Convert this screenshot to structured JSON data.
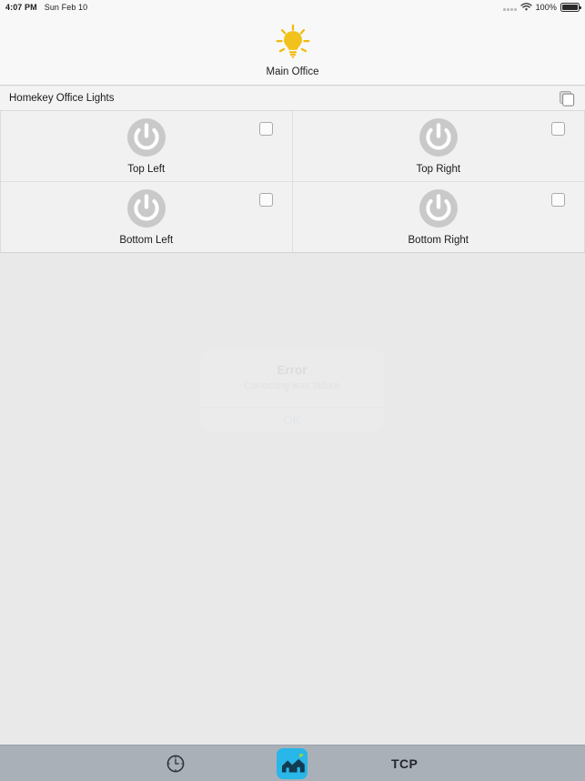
{
  "statusbar": {
    "time": "4:07 PM",
    "date": "Sun Feb 10",
    "battery_percent": "100%",
    "signal_icon": "signal-dots-icon",
    "wifi_icon": "wifi-icon",
    "battery_icon": "battery-full-icon"
  },
  "header": {
    "room_name": "Main Office",
    "room_icon": "lightbulb-icon",
    "icon_color": "#f2b90c"
  },
  "section": {
    "title": "Homekey Office Lights",
    "action_icon": "copy-icon"
  },
  "devices": [
    {
      "label": "Top Left",
      "icon": "power-icon",
      "checked": false
    },
    {
      "label": "Top Right",
      "icon": "power-icon",
      "checked": false
    },
    {
      "label": "Bottom Left",
      "icon": "power-icon",
      "checked": false
    },
    {
      "label": "Bottom Right",
      "icon": "power-icon",
      "checked": false
    }
  ],
  "alert": {
    "title": "Error",
    "message": "Conecting was failure",
    "ok_label": "OK",
    "ok_color": "#007aff"
  },
  "toolbar": {
    "clock_icon": "clock-icon",
    "home_icon": "home-app-icon",
    "tcp_label": "TCP",
    "background": "#aab0b8",
    "home_icon_color": "#29b6e8"
  }
}
